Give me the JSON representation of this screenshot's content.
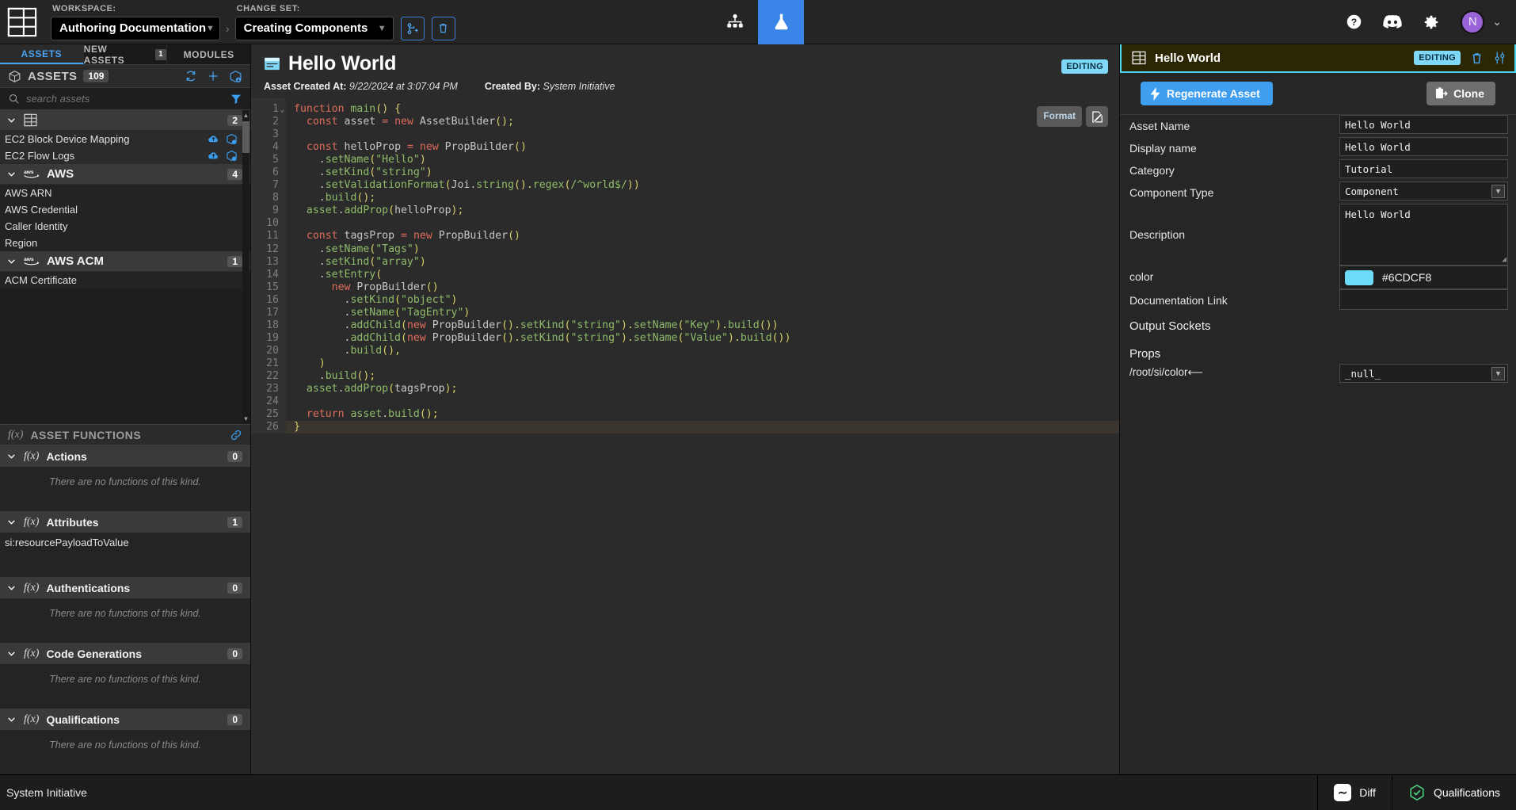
{
  "topbar": {
    "workspace_label": "WORKSPACE:",
    "workspace_value": "Authoring Documentation",
    "changeset_label": "CHANGE SET:",
    "changeset_value": "Creating Components",
    "breadcrumb_sep": "›",
    "merge_icon": "merge-changeset-icon",
    "trash_icon": "delete-changeset-icon",
    "tab_model_icon": "model-hierarchy-icon",
    "tab_lab_icon": "customize-lab-flask-icon",
    "help_icon": "help-icon",
    "discord_icon": "discord-icon",
    "settings_icon": "gear-icon",
    "avatar_initial": "N",
    "avatar_chevron": "⌄",
    "accent_blue": "#3a86e8",
    "avatar_color": "#9a63d8"
  },
  "sidebar": {
    "tabs": [
      {
        "label": "ASSETS",
        "badge": "",
        "active": true
      },
      {
        "label": "NEW ASSETS",
        "badge": "1",
        "active": false
      },
      {
        "label": "MODULES",
        "badge": "",
        "active": false
      }
    ],
    "assets_header": {
      "icon": "cube-icon",
      "title": "ASSETS",
      "count": "109",
      "refresh_icon": "refresh-icon",
      "add_icon": "plus-icon",
      "install_icon": "install-module-icon"
    },
    "search": {
      "placeholder": "search assets",
      "icon": "search-icon",
      "filter_icon": "filter-icon"
    },
    "groups": [
      {
        "name": "",
        "icon": "asset-schema-icon",
        "count": "2",
        "items": [
          {
            "label": "EC2 Block Device Mapping",
            "icons": [
              "cloud-upload-icon",
              "module-icon"
            ]
          },
          {
            "label": "EC2 Flow Logs",
            "icons": [
              "cloud-upload-icon",
              "module-icon"
            ]
          }
        ]
      },
      {
        "name": "AWS",
        "icon": "aws-icon",
        "count": "4",
        "items": [
          {
            "label": "AWS ARN",
            "icons": []
          },
          {
            "label": "AWS Credential",
            "icons": []
          },
          {
            "label": "Caller Identity",
            "icons": []
          },
          {
            "label": "Region",
            "icons": []
          }
        ]
      },
      {
        "name": "AWS ACM",
        "icon": "aws-icon",
        "count": "1",
        "items": [
          {
            "label": "ACM Certificate",
            "icons": []
          }
        ]
      }
    ],
    "functions_header": {
      "title": "ASSET FUNCTIONS",
      "fx_icon": "fx-icon",
      "link_icon": "link-icon"
    },
    "function_sections": [
      {
        "title": "Actions",
        "count": "0",
        "empty": "There are no functions of this kind.",
        "items": []
      },
      {
        "title": "Attributes",
        "count": "1",
        "empty": "",
        "items": [
          "si:resourcePayloadToValue"
        ]
      },
      {
        "title": "Authentications",
        "count": "0",
        "empty": "There are no functions of this kind.",
        "items": []
      },
      {
        "title": "Code Generations",
        "count": "0",
        "empty": "There are no functions of this kind.",
        "items": []
      },
      {
        "title": "Qualifications",
        "count": "0",
        "empty": "There are no functions of this kind.",
        "items": []
      }
    ]
  },
  "editor": {
    "title": "Hello World",
    "title_icon": "asset-card-icon",
    "status_chip": "EDITING",
    "created_at_label": "Asset Created At:",
    "created_at_value": "9/22/2024 at 3:07:04 PM",
    "created_by_label": "Created By:",
    "created_by_value": "System Initiative",
    "format_button": "Format",
    "format_icon": "code-format-icon",
    "active_line": 26,
    "lines": [
      {
        "n": 1,
        "tokens": [
          [
            "k",
            "function"
          ],
          [
            "id",
            " "
          ],
          [
            "fn",
            "main"
          ],
          [
            "pn",
            "()"
          ],
          [
            "id",
            " "
          ],
          [
            "pn",
            "{"
          ]
        ]
      },
      {
        "n": 2,
        "tokens": [
          [
            "id",
            "  "
          ],
          [
            "k",
            "const"
          ],
          [
            "id",
            " "
          ],
          [
            "id",
            "asset"
          ],
          [
            "id",
            " "
          ],
          [
            "k",
            "="
          ],
          [
            "id",
            " "
          ],
          [
            "k",
            "new"
          ],
          [
            "id",
            " "
          ],
          [
            "ty",
            "AssetBuilder"
          ],
          [
            "pn",
            "();"
          ]
        ]
      },
      {
        "n": 3,
        "tokens": []
      },
      {
        "n": 4,
        "tokens": [
          [
            "id",
            "  "
          ],
          [
            "k",
            "const"
          ],
          [
            "id",
            " "
          ],
          [
            "id",
            "helloProp"
          ],
          [
            "id",
            " "
          ],
          [
            "k",
            "="
          ],
          [
            "id",
            " "
          ],
          [
            "k",
            "new"
          ],
          [
            "id",
            " "
          ],
          [
            "ty",
            "PropBuilder"
          ],
          [
            "pn",
            "()"
          ]
        ]
      },
      {
        "n": 5,
        "tokens": [
          [
            "id",
            "    ."
          ],
          [
            "fn",
            "setName"
          ],
          [
            "pn",
            "("
          ],
          [
            "st",
            "\"Hello\""
          ],
          [
            "pn",
            ")"
          ]
        ]
      },
      {
        "n": 6,
        "tokens": [
          [
            "id",
            "    ."
          ],
          [
            "fn",
            "setKind"
          ],
          [
            "pn",
            "("
          ],
          [
            "st",
            "\"string\""
          ],
          [
            "pn",
            ")"
          ]
        ]
      },
      {
        "n": 7,
        "tokens": [
          [
            "id",
            "    ."
          ],
          [
            "fn",
            "setValidationFormat"
          ],
          [
            "pn",
            "("
          ],
          [
            "ty",
            "Joi"
          ],
          [
            "id",
            "."
          ],
          [
            "fn",
            "string"
          ],
          [
            "pn",
            "()."
          ],
          [
            "fn",
            "regex"
          ],
          [
            "pn",
            "("
          ],
          [
            "st",
            "/^world$/"
          ],
          [
            "pn",
            "))"
          ]
        ]
      },
      {
        "n": 8,
        "tokens": [
          [
            "id",
            "    ."
          ],
          [
            "fn",
            "build"
          ],
          [
            "pn",
            "();"
          ]
        ]
      },
      {
        "n": 9,
        "tokens": [
          [
            "id",
            "  "
          ],
          [
            "fn",
            "asset"
          ],
          [
            "id",
            "."
          ],
          [
            "fn",
            "addProp"
          ],
          [
            "pn",
            "("
          ],
          [
            "id",
            "helloProp"
          ],
          [
            "pn",
            ");"
          ]
        ]
      },
      {
        "n": 10,
        "tokens": []
      },
      {
        "n": 11,
        "tokens": [
          [
            "id",
            "  "
          ],
          [
            "k",
            "const"
          ],
          [
            "id",
            " "
          ],
          [
            "id",
            "tagsProp"
          ],
          [
            "id",
            " "
          ],
          [
            "k",
            "="
          ],
          [
            "id",
            " "
          ],
          [
            "k",
            "new"
          ],
          [
            "id",
            " "
          ],
          [
            "ty",
            "PropBuilder"
          ],
          [
            "pn",
            "()"
          ]
        ]
      },
      {
        "n": 12,
        "tokens": [
          [
            "id",
            "    ."
          ],
          [
            "fn",
            "setName"
          ],
          [
            "pn",
            "("
          ],
          [
            "st",
            "\"Tags\""
          ],
          [
            "pn",
            ")"
          ]
        ]
      },
      {
        "n": 13,
        "tokens": [
          [
            "id",
            "    ."
          ],
          [
            "fn",
            "setKind"
          ],
          [
            "pn",
            "("
          ],
          [
            "st",
            "\"array\""
          ],
          [
            "pn",
            ")"
          ]
        ]
      },
      {
        "n": 14,
        "tokens": [
          [
            "id",
            "    ."
          ],
          [
            "fn",
            "setEntry"
          ],
          [
            "pn",
            "("
          ]
        ]
      },
      {
        "n": 15,
        "tokens": [
          [
            "id",
            "      "
          ],
          [
            "k",
            "new"
          ],
          [
            "id",
            " "
          ],
          [
            "ty",
            "PropBuilder"
          ],
          [
            "pn",
            "()"
          ]
        ]
      },
      {
        "n": 16,
        "tokens": [
          [
            "id",
            "        ."
          ],
          [
            "fn",
            "setKind"
          ],
          [
            "pn",
            "("
          ],
          [
            "st",
            "\"object\""
          ],
          [
            "pn",
            ")"
          ]
        ]
      },
      {
        "n": 17,
        "tokens": [
          [
            "id",
            "        ."
          ],
          [
            "fn",
            "setName"
          ],
          [
            "pn",
            "("
          ],
          [
            "st",
            "\"TagEntry\""
          ],
          [
            "pn",
            ")"
          ]
        ]
      },
      {
        "n": 18,
        "tokens": [
          [
            "id",
            "        ."
          ],
          [
            "fn",
            "addChild"
          ],
          [
            "pn",
            "("
          ],
          [
            "k",
            "new"
          ],
          [
            "id",
            " "
          ],
          [
            "ty",
            "PropBuilder"
          ],
          [
            "pn",
            "()."
          ],
          [
            "fn",
            "setKind"
          ],
          [
            "pn",
            "("
          ],
          [
            "st",
            "\"string\""
          ],
          [
            "pn",
            ")."
          ],
          [
            "fn",
            "setName"
          ],
          [
            "pn",
            "("
          ],
          [
            "st",
            "\"Key\""
          ],
          [
            "pn",
            ")."
          ],
          [
            "fn",
            "build"
          ],
          [
            "pn",
            "())"
          ]
        ]
      },
      {
        "n": 19,
        "tokens": [
          [
            "id",
            "        ."
          ],
          [
            "fn",
            "addChild"
          ],
          [
            "pn",
            "("
          ],
          [
            "k",
            "new"
          ],
          [
            "id",
            " "
          ],
          [
            "ty",
            "PropBuilder"
          ],
          [
            "pn",
            "()."
          ],
          [
            "fn",
            "setKind"
          ],
          [
            "pn",
            "("
          ],
          [
            "st",
            "\"string\""
          ],
          [
            "pn",
            ")."
          ],
          [
            "fn",
            "setName"
          ],
          [
            "pn",
            "("
          ],
          [
            "st",
            "\"Value\""
          ],
          [
            "pn",
            ")."
          ],
          [
            "fn",
            "build"
          ],
          [
            "pn",
            "())"
          ]
        ]
      },
      {
        "n": 20,
        "tokens": [
          [
            "id",
            "        ."
          ],
          [
            "fn",
            "build"
          ],
          [
            "pn",
            "(),"
          ]
        ]
      },
      {
        "n": 21,
        "tokens": [
          [
            "id",
            "    "
          ],
          [
            "pn",
            ")"
          ]
        ]
      },
      {
        "n": 22,
        "tokens": [
          [
            "id",
            "    ."
          ],
          [
            "fn",
            "build"
          ],
          [
            "pn",
            "();"
          ]
        ]
      },
      {
        "n": 23,
        "tokens": [
          [
            "id",
            "  "
          ],
          [
            "fn",
            "asset"
          ],
          [
            "id",
            "."
          ],
          [
            "fn",
            "addProp"
          ],
          [
            "pn",
            "("
          ],
          [
            "id",
            "tagsProp"
          ],
          [
            "pn",
            ");"
          ]
        ]
      },
      {
        "n": 24,
        "tokens": []
      },
      {
        "n": 25,
        "tokens": [
          [
            "id",
            "  "
          ],
          [
            "k",
            "return"
          ],
          [
            "id",
            " "
          ],
          [
            "fn",
            "asset"
          ],
          [
            "id",
            "."
          ],
          [
            "fn",
            "build"
          ],
          [
            "pn",
            "();"
          ]
        ]
      },
      {
        "n": 26,
        "tokens": [
          [
            "pn",
            "}"
          ]
        ]
      }
    ]
  },
  "rightpanel": {
    "header": {
      "icon": "asset-schema-icon",
      "title": "Hello World",
      "status_chip": "EDITING",
      "trash_icon": "delete-asset-icon",
      "sliders_icon": "settings-sliders-icon",
      "border_color": "#49d4f0",
      "bg_color": "#2b2705"
    },
    "actions": {
      "regenerate_label": "Regenerate Asset",
      "regenerate_icon": "lightning-bolt-icon",
      "clone_label": "Clone",
      "clone_icon": "clone-icon"
    },
    "fields": [
      {
        "label": "Asset Name",
        "value": "Hello World",
        "type": "text"
      },
      {
        "label": "Display name",
        "value": "Hello World",
        "type": "text"
      },
      {
        "label": "Category",
        "value": "Tutorial",
        "type": "text"
      },
      {
        "label": "Component Type",
        "value": "Component",
        "type": "select"
      },
      {
        "label": "Description",
        "value": "Hello World",
        "type": "textarea"
      },
      {
        "label": "color",
        "value": "#6CDCF8",
        "type": "color"
      },
      {
        "label": "Documentation Link",
        "value": "",
        "type": "text"
      }
    ],
    "output_sockets_title": "Output Sockets",
    "props_title": "Props",
    "props": [
      {
        "label": "/root/si/color⟵",
        "value": "_null_",
        "type": "select"
      }
    ]
  },
  "bottombar": {
    "left_text": "System Initiative",
    "items": [
      {
        "label": "Diff",
        "icon": "diff-icon",
        "glyph": "∼"
      },
      {
        "label": "Qualifications",
        "icon": "qualification-hex-check-icon",
        "glyph": ""
      }
    ]
  }
}
